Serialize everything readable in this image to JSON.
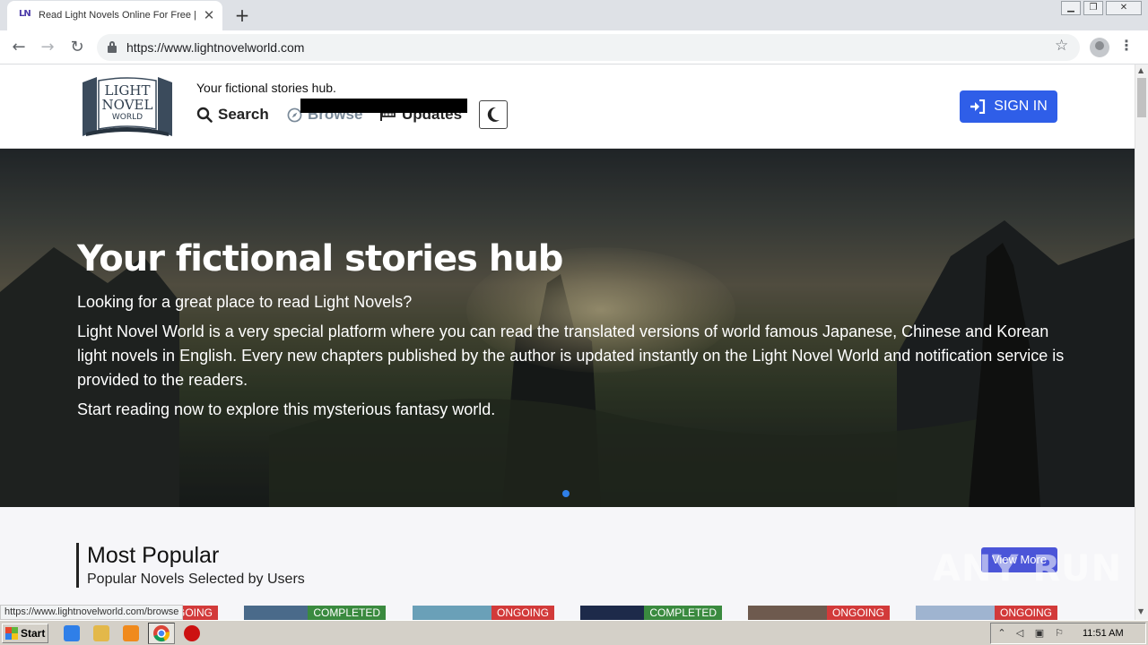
{
  "browser": {
    "tab_title": "Read Light Novels Online For Free | L",
    "favicon_text": "LN",
    "url": "https://www.lightnovelworld.com",
    "status_url": "https://www.lightnovelworld.com/browse"
  },
  "header": {
    "logo": "LIGHT NOVEL WORLD",
    "tagline": "Your fictional stories hub.",
    "nav": {
      "search": "Search",
      "browse": "Browse",
      "updates": "Updates"
    },
    "signin": "SIGN IN"
  },
  "hero": {
    "title": "Your fictional stories hub",
    "p1": "Looking for a great place to read Light Novels?",
    "p2": "Light Novel World is a very special platform where you can read the translated versions of world famous Japanese, Chinese and Korean light novels in English. Every new chapters published by the author is updated instantly on the Light Novel World and notification service is provided to the readers.",
    "p3": "Start reading now to explore this mysterious fantasy world."
  },
  "popular": {
    "title": "Most Popular",
    "subtitle": "Popular Novels Selected by Users",
    "view_more": "View More",
    "cards": [
      {
        "status": "ONGOING"
      },
      {
        "status": "COMPLETED"
      },
      {
        "status": "ONGOING"
      },
      {
        "status": "COMPLETED"
      },
      {
        "status": "ONGOING"
      },
      {
        "status": "ONGOING"
      }
    ]
  },
  "watermark": "ANY RUN",
  "taskbar": {
    "start": "Start",
    "clock": "11:51 AM"
  },
  "colors": {
    "accent": "#2f5ee8",
    "ongoing": "#d23a3a",
    "completed": "#3a8a3f"
  }
}
